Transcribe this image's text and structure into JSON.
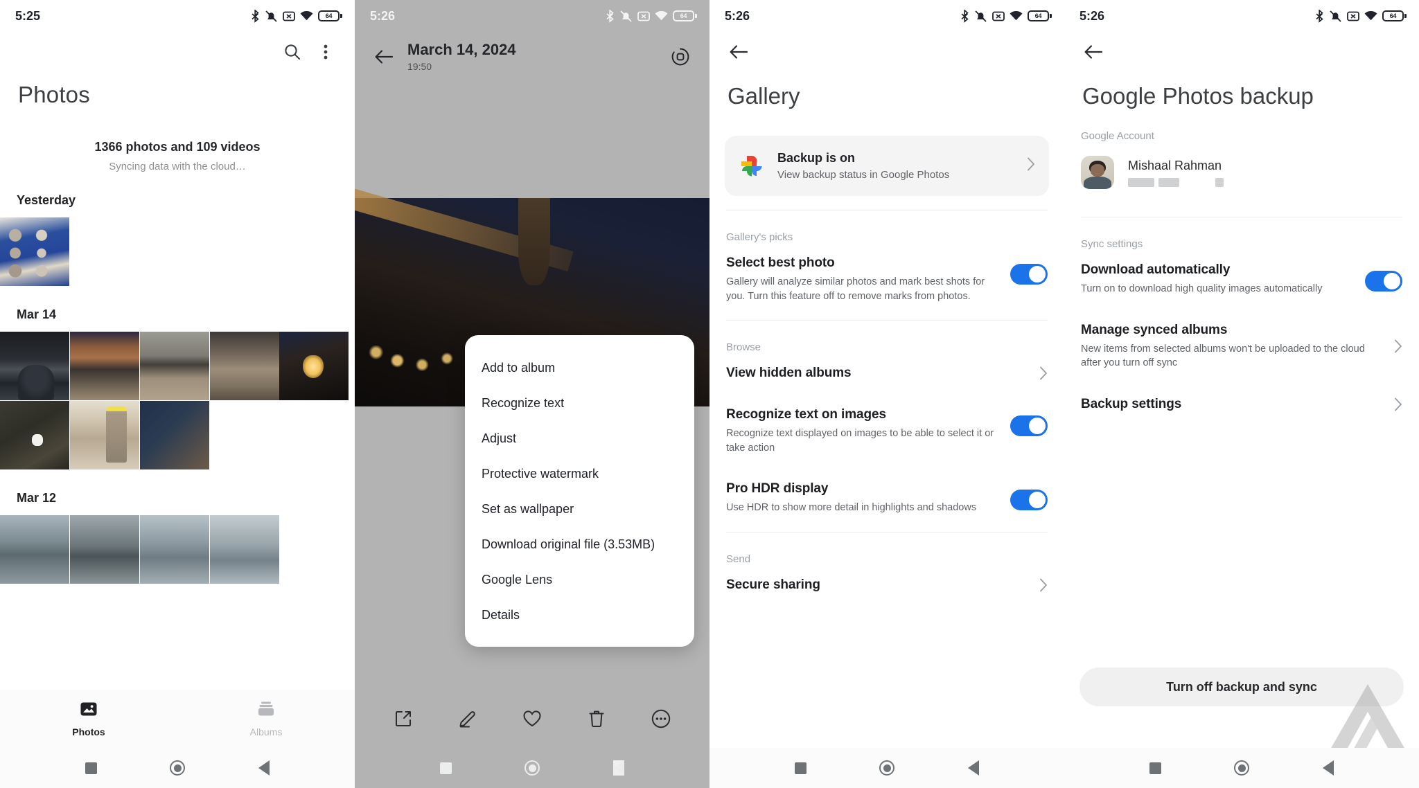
{
  "screens": {
    "photos": {
      "status": {
        "time": "5:25",
        "battery": "64"
      },
      "title": "Photos",
      "search_icon": "search-icon",
      "overflow_icon": "more-vertical-icon",
      "count": "1366 photos and 109 videos",
      "sync_status": "Syncing data with the cloud…",
      "sections": [
        {
          "date": "Yesterday",
          "photos": 1
        },
        {
          "date": "Mar 14",
          "photos": 8
        },
        {
          "date": "Mar 12",
          "photos": 4
        }
      ],
      "nav": [
        {
          "label": "Photos",
          "icon": "image-icon",
          "active": true
        },
        {
          "label": "Albums",
          "icon": "albums-icon",
          "active": false
        }
      ]
    },
    "viewer": {
      "status": {
        "time": "5:26",
        "battery": "64"
      },
      "back_icon": "back-arrow-icon",
      "title": "March 14, 2024",
      "subtitle": "19:50",
      "action_icon": "lens-circle-icon",
      "menu_items": [
        "Add to album",
        "Recognize text",
        "Adjust",
        "Protective watermark",
        "Set as wallpaper",
        "Download original file (3.53MB)",
        "Google Lens",
        "Details"
      ],
      "toolbar": [
        {
          "name": "share-icon"
        },
        {
          "name": "edit-pencil-icon"
        },
        {
          "name": "heart-icon"
        },
        {
          "name": "trash-icon"
        },
        {
          "name": "more-horizontal-icon"
        }
      ]
    },
    "gallery_settings": {
      "status": {
        "time": "5:26",
        "battery": "64"
      },
      "back_icon": "back-arrow-icon",
      "title": "Gallery",
      "backup_card": {
        "icon": "google-photos-logo",
        "title": "Backup is on",
        "subtitle": "View backup status in Google Photos"
      },
      "sections": [
        {
          "label": "Gallery's picks",
          "rows": [
            {
              "title": "Select best photo",
              "subtitle": "Gallery will analyze similar photos and mark best shots for you. Turn this feature off to remove marks from photos.",
              "control": "toggle",
              "value": "on"
            }
          ]
        },
        {
          "label": "Browse",
          "rows": [
            {
              "title": "View hidden albums",
              "subtitle": "",
              "control": "chevron",
              "value": ""
            },
            {
              "title": "Recognize text on images",
              "subtitle": "Recognize text displayed on images to be able to select it or take action",
              "control": "toggle",
              "value": "on"
            },
            {
              "title": "Pro HDR display",
              "subtitle": "Use HDR to show more detail in highlights and shadows",
              "control": "toggle",
              "value": "on"
            }
          ]
        },
        {
          "label": "Send",
          "rows": [
            {
              "title": "Secure sharing",
              "subtitle": "",
              "control": "chevron",
              "value": ""
            }
          ]
        }
      ]
    },
    "backup_settings": {
      "status": {
        "time": "5:26",
        "battery": "64"
      },
      "back_icon": "back-arrow-icon",
      "title": "Google Photos backup",
      "account_label": "Google Account",
      "account_name": "Mishaal Rahman",
      "sync_label": "Sync settings",
      "rows": [
        {
          "title": "Download automatically",
          "subtitle": "Turn on to download high quality images automatically",
          "control": "toggle",
          "value": "on"
        },
        {
          "title": "Manage synced albums",
          "subtitle": "New items from selected albums won't be uploaded to the cloud after you turn off sync",
          "control": "chevron",
          "value": ""
        },
        {
          "title": "Backup settings",
          "subtitle": "",
          "control": "chevron",
          "value": ""
        }
      ],
      "turn_off_button": "Turn off backup and sync"
    }
  },
  "colors": {
    "accent_blue": "#1a73e8",
    "viewer_chrome": "#b3b3b3",
    "card_grey": "#f4f4f4",
    "secondary_text": "#5f6368",
    "label_text": "#9aa0a6"
  },
  "system_nav": {
    "recents_icon": "square-icon",
    "home_icon": "circle-icon",
    "back_icon": "triangle-back-icon"
  }
}
